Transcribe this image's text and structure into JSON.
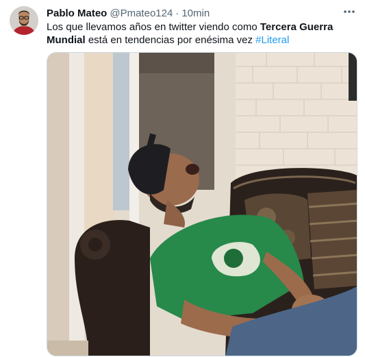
{
  "tweet": {
    "author_name": "Pablo Mateo",
    "author_handle": "@Pmateo124",
    "separator": "·",
    "timestamp": "10min",
    "text_part1": "Los que llevamos años en twitter viendo como ",
    "text_bold": "Tercera Guerra Mundial",
    "text_part2": " está en tendencias por enésima vez ",
    "hashtag": "#Literal"
  },
  "icons": {
    "more": "more-horizontal-icon"
  },
  "colors": {
    "text_primary": "#0f1419",
    "text_secondary": "#536471",
    "link": "#1d9bf0",
    "border": "#cfd9de"
  }
}
